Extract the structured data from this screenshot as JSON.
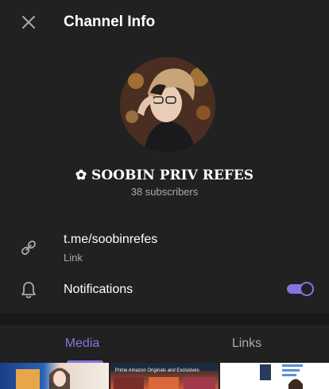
{
  "header": {
    "title": "Channel Info",
    "close_icon": "close-icon"
  },
  "channel": {
    "name": "✿ SOOBIN PRIV REFES",
    "subscribers": "38 subscribers"
  },
  "info": {
    "link": {
      "icon": "link-icon",
      "value": "t.me/soobinrefes",
      "label": "Link"
    },
    "notifications": {
      "icon": "bell-icon",
      "label": "Notifications",
      "enabled": true
    }
  },
  "tabs": [
    {
      "label": "Media",
      "active": true
    },
    {
      "label": "Links",
      "active": false
    }
  ],
  "media": {
    "thumb2_caption": "Prime Amazon Originals and Exclusives"
  },
  "colors": {
    "background": "#212121",
    "accent": "#8774e1",
    "secondary_text": "#aaaaaa"
  }
}
